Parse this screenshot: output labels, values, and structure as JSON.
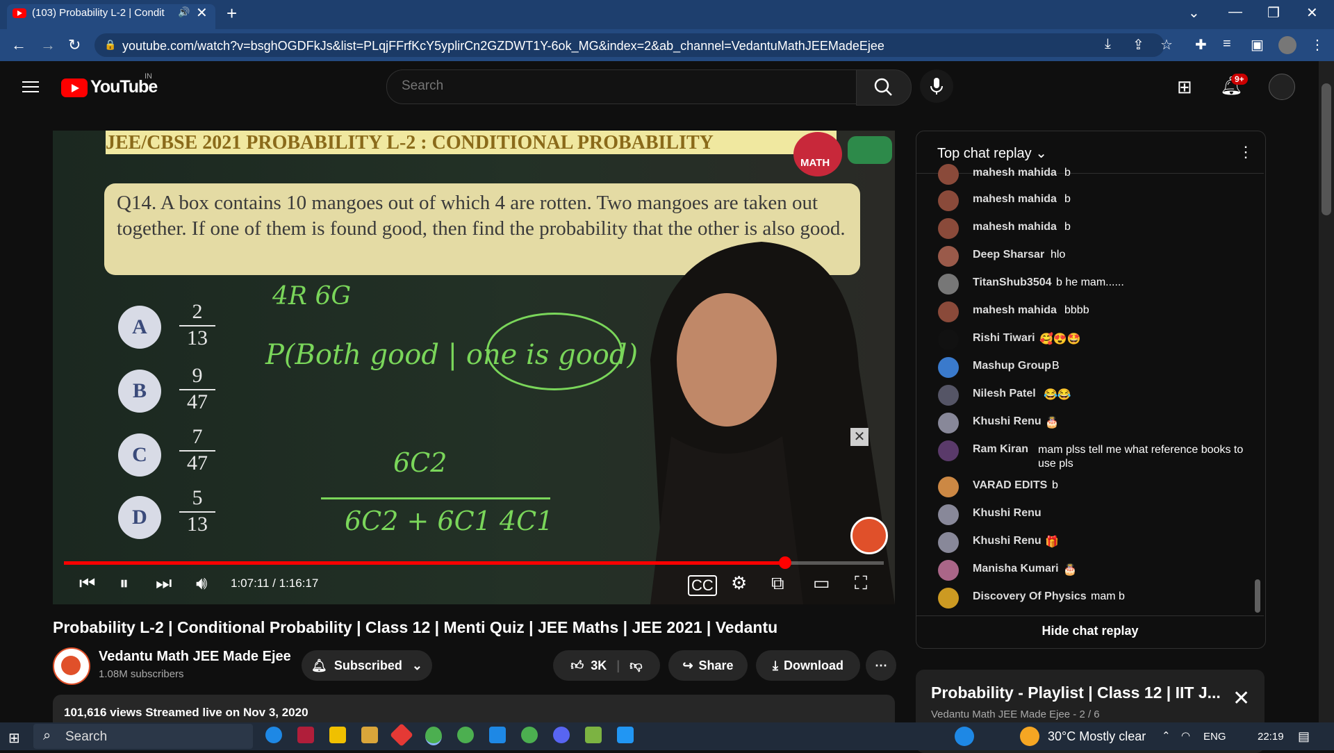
{
  "browser": {
    "tab_title": "(103) Probability L-2 | Condit",
    "url": "youtube.com/watch?v=bsghOGDFkJs&list=PLqjFFrfKcY5yplirCn2GZDWT1Y-6ok_MG&index=2&ab_channel=VedantuMathJEEMadeEjee"
  },
  "header": {
    "logo_text": "YouTube",
    "country": "IN",
    "search_placeholder": "Search",
    "notification_count": "9+"
  },
  "video": {
    "banner": "JEE/CBSE 2021 PROBABILITY L-2 : CONDITIONAL PROBABILITY",
    "badge": "MATH",
    "question": "Q14. A box contains 10 mangoes out of which 4 are rotten. Two mangoes are taken out together. If one of them is found good, then find the probability that the other is also good.",
    "options": [
      {
        "letter": "A",
        "num": "2",
        "den": "13"
      },
      {
        "letter": "B",
        "num": "9",
        "den": "47"
      },
      {
        "letter": "C",
        "num": "7",
        "den": "47"
      },
      {
        "letter": "D",
        "num": "5",
        "den": "13"
      }
    ],
    "chalk": {
      "line1": "4R 6G",
      "line2": "P(Both good | one is good)",
      "numerator": "6C2",
      "denominator": "6C2 + 6C1 4C1"
    },
    "time": "1:07:11 / 1:16:17",
    "progress": 0.88
  },
  "below": {
    "title": "Probability L-2 | Conditional Probability | Class 12 | Menti Quiz | JEE Maths | JEE 2021 | Vedantu",
    "channel": "Vedantu Math JEE Made Ejee",
    "subscribers": "1.08M subscribers",
    "subscribed_label": "Subscribed",
    "likes": "3K",
    "share_label": "Share",
    "download_label": "Download",
    "meta": "101,616 views  Streamed live on Nov 3, 2020"
  },
  "chat": {
    "header": "Top chat replay",
    "hide_label": "Hide chat replay",
    "messages": [
      {
        "author": "mahesh mahida",
        "text": "b",
        "color": "#8a4a3a"
      },
      {
        "author": "mahesh mahida",
        "text": "b",
        "color": "#8a4a3a"
      },
      {
        "author": "mahesh mahida",
        "text": "b",
        "color": "#8a4a3a"
      },
      {
        "author": "Deep Sharsar",
        "text": "hlo",
        "color": "#9a5a4a"
      },
      {
        "author": "TitanShub3504",
        "text": "b he mam......",
        "color": "#777777"
      },
      {
        "author": "mahesh mahida",
        "text": "bbbb",
        "color": "#8a4a3a"
      },
      {
        "author": "Rishi Tiwari",
        "text": "🥰😍🤩",
        "color": "#111111"
      },
      {
        "author": "Mashup Group",
        "text": "B",
        "color": "#3a7acc"
      },
      {
        "author": "Nilesh Patel",
        "text": "😂😂",
        "color": "#555566"
      },
      {
        "author": "Khushi Renu",
        "text": "🎂",
        "color": "#888899"
      },
      {
        "author": "Ram Kiran",
        "text": "mam plss tell me what reference books to use pls",
        "color": "#5a3a6a"
      },
      {
        "author": "VARAD EDITS",
        "text": "b",
        "color": "#cc8844"
      },
      {
        "author": "Khushi Renu",
        "text": "",
        "color": "#888899"
      },
      {
        "author": "Khushi Renu",
        "text": "🎁",
        "color": "#888899"
      },
      {
        "author": "Manisha Kumari",
        "text": "🎂",
        "color": "#aa6688"
      },
      {
        "author": "Discovery Of Physics",
        "text": "mam b",
        "color": "#cc9a22"
      }
    ]
  },
  "playlist": {
    "title": "Probability - Playlist | Class 12 | IIT J...",
    "subtitle": "Vedantu Math JEE Made Ejee - 2 / 6"
  },
  "taskbar": {
    "search": "Search",
    "weather": "30°C  Mostly clear",
    "lang": "ENG",
    "time": "22:19"
  }
}
